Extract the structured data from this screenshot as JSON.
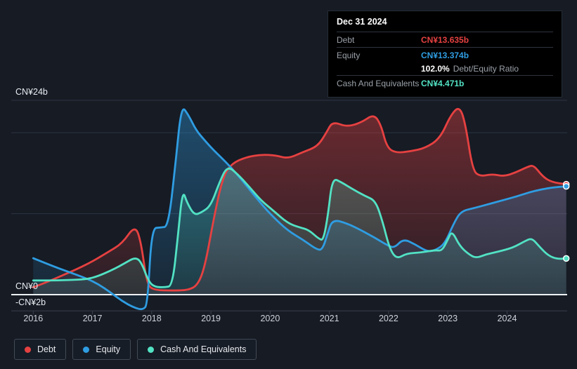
{
  "tooltip": {
    "date": "Dec 31 2024",
    "debt_label": "Debt",
    "debt_value": "CN¥13.635b",
    "equity_label": "Equity",
    "equity_value": "CN¥13.374b",
    "ratio_value": "102.0%",
    "ratio_label": "Debt/Equity Ratio",
    "cash_label": "Cash And Equivalents",
    "cash_value": "CN¥4.471b"
  },
  "legend": {
    "items": [
      {
        "id": "debt",
        "label": "Debt",
        "color": "#e64141"
      },
      {
        "id": "equity",
        "label": "Equity",
        "color": "#2f9de2"
      },
      {
        "id": "cash",
        "label": "Cash And Equivalents",
        "color": "#52e2c4"
      }
    ]
  },
  "colors": {
    "background": "#161b24",
    "gridline": "#2d3442",
    "zero_line": "#eef1f4",
    "axis_line": "#3a414d",
    "debt": "#e64141",
    "equity": "#2f9de2",
    "cash": "#52e2c4",
    "tooltip_bg": "#000000"
  },
  "chart_data": {
    "type": "area",
    "units": "CN¥ billions",
    "x_axis": {
      "min": 2016,
      "max": 2025,
      "tick_years": [
        2016,
        2017,
        2018,
        2019,
        2020,
        2021,
        2022,
        2023,
        2024
      ]
    },
    "y_axis": {
      "min": -2,
      "max": 24,
      "ticks": [
        {
          "label": "CN¥24b",
          "value": 24
        },
        {
          "label": "CN¥0",
          "value": 0
        },
        {
          "label": "-CN¥2b",
          "value": -2
        }
      ],
      "unlabeled_gridlines": [
        20,
        10
      ]
    },
    "legend_position": "bottom-left",
    "series": [
      {
        "name": "Debt",
        "color": "#e64141",
        "end_value": 13.635,
        "points": [
          [
            2016,
            0.9
          ],
          [
            2016.25,
            1.6
          ],
          [
            2016.5,
            2.4
          ],
          [
            2016.75,
            3.2
          ],
          [
            2017,
            4.1
          ],
          [
            2017.25,
            5.2
          ],
          [
            2017.5,
            6.3
          ],
          [
            2017.72,
            8.6
          ],
          [
            2017.82,
            6.5
          ],
          [
            2017.92,
            1.2
          ],
          [
            2018.05,
            0.55
          ],
          [
            2018.35,
            0.5
          ],
          [
            2018.62,
            0.55
          ],
          [
            2018.78,
            1.2
          ],
          [
            2018.9,
            3.5
          ],
          [
            2019.05,
            9.5
          ],
          [
            2019.2,
            14.5
          ],
          [
            2019.35,
            16.2
          ],
          [
            2019.6,
            17
          ],
          [
            2019.85,
            17.3
          ],
          [
            2020.1,
            17.2
          ],
          [
            2020.3,
            16.8
          ],
          [
            2020.55,
            17.6
          ],
          [
            2020.8,
            18.3
          ],
          [
            2020.95,
            20
          ],
          [
            2021.05,
            21.4
          ],
          [
            2021.3,
            20.7
          ],
          [
            2021.55,
            21.3
          ],
          [
            2021.75,
            22.3
          ],
          [
            2021.87,
            21
          ],
          [
            2021.97,
            18.2
          ],
          [
            2022.12,
            17.5
          ],
          [
            2022.37,
            17.7
          ],
          [
            2022.62,
            18.1
          ],
          [
            2022.87,
            19.3
          ],
          [
            2023.05,
            22.2
          ],
          [
            2023.2,
            23.3
          ],
          [
            2023.3,
            21
          ],
          [
            2023.42,
            15.3
          ],
          [
            2023.55,
            14.6
          ],
          [
            2023.75,
            14.9
          ],
          [
            2023.95,
            14.6
          ],
          [
            2024.15,
            15.1
          ],
          [
            2024.35,
            15.8
          ],
          [
            2024.45,
            16
          ],
          [
            2024.6,
            14.6
          ],
          [
            2024.75,
            13.9
          ],
          [
            2025,
            13.635
          ]
        ]
      },
      {
        "name": "Equity",
        "color": "#2f9de2",
        "end_value": 13.374,
        "points": [
          [
            2016,
            4.5
          ],
          [
            2016.3,
            3.6
          ],
          [
            2016.6,
            2.8
          ],
          [
            2016.9,
            2
          ],
          [
            2017.1,
            1.3
          ],
          [
            2017.3,
            0.3
          ],
          [
            2017.5,
            -0.8
          ],
          [
            2017.7,
            -1.6
          ],
          [
            2017.85,
            -1.9
          ],
          [
            2017.93,
            -1.2
          ],
          [
            2018,
            8.2
          ],
          [
            2018.15,
            8.3
          ],
          [
            2018.28,
            8.4
          ],
          [
            2018.4,
            16
          ],
          [
            2018.5,
            23.4
          ],
          [
            2018.62,
            22.2
          ],
          [
            2018.75,
            20.3
          ],
          [
            2018.9,
            19
          ],
          [
            2019.05,
            17.8
          ],
          [
            2019.25,
            16.4
          ],
          [
            2019.45,
            14.8
          ],
          [
            2019.65,
            13
          ],
          [
            2019.85,
            11.2
          ],
          [
            2020.05,
            9.6
          ],
          [
            2020.3,
            7.9
          ],
          [
            2020.55,
            6.8
          ],
          [
            2020.78,
            5.6
          ],
          [
            2020.88,
            5.5
          ],
          [
            2020.97,
            7.5
          ],
          [
            2021.05,
            9.3
          ],
          [
            2021.3,
            8.8
          ],
          [
            2021.55,
            7.9
          ],
          [
            2021.8,
            6.9
          ],
          [
            2022,
            6
          ],
          [
            2022.1,
            5.8
          ],
          [
            2022.25,
            6.9
          ],
          [
            2022.45,
            6.2
          ],
          [
            2022.65,
            5.3
          ],
          [
            2022.8,
            5.5
          ],
          [
            2022.95,
            6.3
          ],
          [
            2023.1,
            8.8
          ],
          [
            2023.22,
            10.3
          ],
          [
            2023.45,
            10.7
          ],
          [
            2023.65,
            11.1
          ],
          [
            2023.9,
            11.6
          ],
          [
            2024.15,
            12.1
          ],
          [
            2024.4,
            12.7
          ],
          [
            2024.65,
            13.1
          ],
          [
            2024.85,
            13.3
          ],
          [
            2025,
            13.374
          ]
        ]
      },
      {
        "name": "Cash And Equivalents",
        "color": "#52e2c4",
        "end_value": 4.471,
        "points": [
          [
            2016,
            1.75
          ],
          [
            2016.3,
            1.75
          ],
          [
            2016.6,
            1.8
          ],
          [
            2016.9,
            1.9
          ],
          [
            2017.1,
            2.3
          ],
          [
            2017.35,
            3.1
          ],
          [
            2017.55,
            3.9
          ],
          [
            2017.72,
            4.6
          ],
          [
            2017.82,
            4.1
          ],
          [
            2017.95,
            1.6
          ],
          [
            2018.05,
            0.95
          ],
          [
            2018.22,
            0.9
          ],
          [
            2018.35,
            1.1
          ],
          [
            2018.44,
            7
          ],
          [
            2018.52,
            13
          ],
          [
            2018.6,
            11.3
          ],
          [
            2018.72,
            9.8
          ],
          [
            2018.85,
            10.2
          ],
          [
            2019,
            11
          ],
          [
            2019.15,
            14
          ],
          [
            2019.28,
            15.9
          ],
          [
            2019.45,
            14.9
          ],
          [
            2019.65,
            13.3
          ],
          [
            2019.85,
            11.6
          ],
          [
            2020.05,
            10.4
          ],
          [
            2020.3,
            8.8
          ],
          [
            2020.5,
            8.3
          ],
          [
            2020.65,
            8
          ],
          [
            2020.82,
            6.9
          ],
          [
            2020.9,
            6.7
          ],
          [
            2020.98,
            10
          ],
          [
            2021.05,
            14.4
          ],
          [
            2021.2,
            13.9
          ],
          [
            2021.4,
            13
          ],
          [
            2021.6,
            12.2
          ],
          [
            2021.78,
            11.6
          ],
          [
            2021.9,
            9
          ],
          [
            2022.02,
            5.6
          ],
          [
            2022.14,
            4.4
          ],
          [
            2022.3,
            5.1
          ],
          [
            2022.55,
            5.2
          ],
          [
            2022.78,
            5.5
          ],
          [
            2022.9,
            5.4
          ],
          [
            2023,
            6.8
          ],
          [
            2023.07,
            7.9
          ],
          [
            2023.2,
            6
          ],
          [
            2023.35,
            5
          ],
          [
            2023.48,
            4.5
          ],
          [
            2023.65,
            5
          ],
          [
            2023.85,
            5.3
          ],
          [
            2024.1,
            5.8
          ],
          [
            2024.3,
            6.6
          ],
          [
            2024.42,
            7
          ],
          [
            2024.55,
            5.9
          ],
          [
            2024.7,
            4.8
          ],
          [
            2024.85,
            4.4
          ],
          [
            2025,
            4.471
          ]
        ]
      }
    ]
  }
}
